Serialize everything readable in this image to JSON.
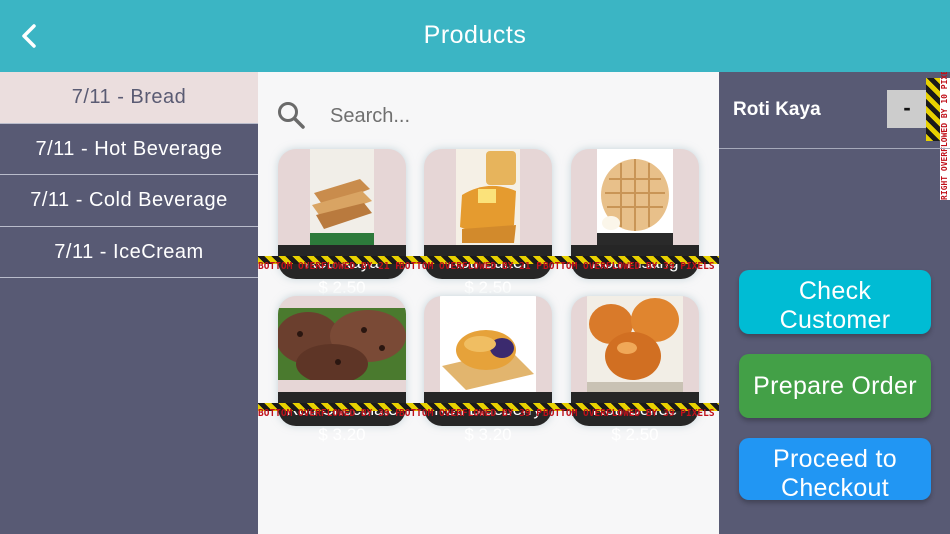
{
  "appbar": {
    "title": "Products",
    "back_icon": "chevron-left-icon"
  },
  "sidebar": {
    "categories": [
      {
        "label": "7/11 - Bread",
        "selected": true
      },
      {
        "label": "7/11 - Hot Beverage",
        "selected": false
      },
      {
        "label": "7/11 - Cold Beverage",
        "selected": false
      },
      {
        "label": "7/11 - IceCream",
        "selected": false
      }
    ]
  },
  "search": {
    "placeholder": "Search...",
    "value": "",
    "icon": "search-icon"
  },
  "products": [
    {
      "name": "Roti Kaya",
      "price": "$ 2.50",
      "overflow": "BOTTOM OVERFLOWED BY 21 PIXELS"
    },
    {
      "name": "Roti Butter",
      "price": "$ 2.50",
      "overflow": "BOTTOM OVERFLOWED BY 21 PIXELS"
    },
    {
      "name": "Roti Pisang",
      "price": "",
      "overflow": "BOTTOM OVERFLOWED BY 39 PIXELS"
    },
    {
      "name": "Roti Chocolate",
      "price": "$ 3.20",
      "overflow": "BOTTOM OVERFLOWED BY 39 PIXELS"
    },
    {
      "name": "Roti Blueberry",
      "price": "$ 3.20",
      "overflow": "BOTTOM OVERFLOWED BY 39 PIXELS"
    },
    {
      "name": "Roti Coffee",
      "price": "$ 2.50",
      "overflow": "BOTTOM OVERFLOWED BY 39 PIXELS"
    }
  ],
  "order_panel": {
    "item_name": "Roti Kaya",
    "minus_label": "-",
    "overflow_label": "RIGHT OVERFLOWED BY 10 PIXELS"
  },
  "actions": {
    "check_customer": {
      "line1": "Check",
      "line2": "Customer",
      "color": "#00bcd4"
    },
    "prepare_order": {
      "label": "Prepare Order",
      "color": "#43a047"
    },
    "proceed_checkout": {
      "line1": "Proceed to",
      "line2": "Checkout",
      "color": "#2196f3"
    }
  },
  "colors": {
    "appbar": "#3bb5c4",
    "sidebar": "#585a74",
    "selected_category": "#ebdede",
    "card": "#e6d6d6",
    "overflow_text": "#c0101a"
  }
}
